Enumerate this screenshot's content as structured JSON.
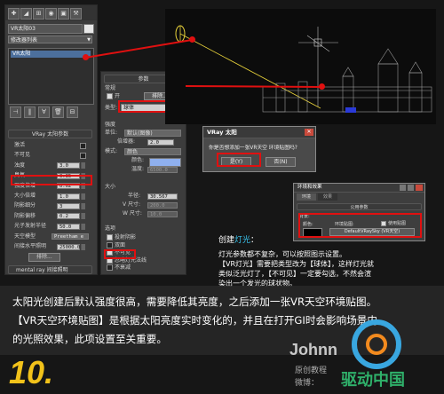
{
  "left_panel": {
    "object_name": "VR太阳03",
    "modifier_list": "修改器列表",
    "stack_item": "VR太阳",
    "rollout_title": "VRay 太阳参数",
    "params": [
      {
        "label": "激活",
        "value": "",
        "kind": "check"
      },
      {
        "label": "不可见",
        "value": "",
        "kind": "check"
      },
      {
        "label": "浊度",
        "value": "3.0",
        "kind": "spin"
      },
      {
        "label": "臭氧",
        "value": "0.35",
        "kind": "spin"
      },
      {
        "label": "强度倍增",
        "value": "0.02",
        "kind": "spin"
      },
      {
        "label": "大小倍增",
        "value": "1.0",
        "kind": "spin"
      },
      {
        "label": "阴影细分",
        "value": "3",
        "kind": "spin"
      },
      {
        "label": "阴影偏移",
        "value": "0.2",
        "kind": "spin"
      },
      {
        "label": "光子发射半径",
        "value": "50.0",
        "kind": "spin"
      },
      {
        "label": "天空模型",
        "value": "Preetham e",
        "kind": "drop"
      },
      {
        "label": "间接水平照明",
        "value": "25000.0",
        "kind": "spin"
      },
      {
        "label": "排除...",
        "value": "",
        "kind": "btn"
      }
    ],
    "footer": "mental ray 间接照明"
  },
  "mid_panel": {
    "rollout_title": "参数",
    "general_group": "常规",
    "on_label": "开",
    "exclude_button": "排除...",
    "type_label": "类型:",
    "type_value": "球体",
    "intensity_group": "强度",
    "unit_label": "单位:",
    "unit_value": "默认(图像)",
    "multiplier_label": "倍增器:",
    "multiplier_value": "2.0",
    "mode_label": "模式:",
    "mode_value": "颜色",
    "color_label": "颜色:",
    "temp_label": "温度:",
    "temp_value": "6500.0",
    "size_group": "大小",
    "half_len_label": "半径:",
    "half_len_value": "30.567",
    "vsize_label": "V 尺寸:",
    "vsize_value": "200.0",
    "wsize_label": "W 尺寸:",
    "wsize_value": "10.0",
    "options_group": "选项",
    "options": [
      {
        "label": "投射阴影",
        "checked": true
      },
      {
        "label": "双面",
        "checked": false
      },
      {
        "label": "不可见",
        "checked": true
      },
      {
        "label": "忽略灯光法线",
        "checked": true
      },
      {
        "label": "不衰减",
        "checked": false
      }
    ]
  },
  "dialog_vray": {
    "title": "VRay 太阳",
    "message": "你是否想添加一张VR天空 环境贴图吗?",
    "yes": "是(Y)",
    "no": "否(N)"
  },
  "dialog_env": {
    "title": "环境和效果",
    "tab_env": "环境",
    "tab_effects": "效果",
    "rollout": "公用参数",
    "bg_group": "背景:",
    "color_label": "颜色:",
    "envmap_label": "环境贴图:",
    "use_map_label": "使用贴图",
    "map_button": "DefaultVRaySky (VR天空)"
  },
  "notes": {
    "heading_prefix": "创建",
    "heading_accent": "灯光",
    "heading_suffix": "：",
    "lines": [
      "灯光参数都不复杂，可以按照图示设置。",
      "【VR灯光】需要把类型改为【球体】，这样灯光就",
      "类似泛光灯了，【不可见】一定要勾选，不然会渲",
      "染出一个发光的球状物。"
    ]
  },
  "caption": {
    "lines": [
      "太阳光创建后默认强度很高，需要降低其亮度，之后添加一张VR天空环境贴图。",
      "【VR天空环境贴图】是根据太阳亮度实时变化的，并且在打开GI时会影响场景内",
      "的光照效果，此项设置至关重要。"
    ]
  },
  "step_number": "10.",
  "watermark": {
    "brand": "Johnn",
    "line1": "原创教程",
    "line2": "微博：",
    "site": "驱动中国"
  },
  "colors": {
    "highlight_red": "#e01010",
    "step_yellow": "#f2c21a",
    "accent_cyan": "#39c6f0",
    "caption_bg": "#2c2c2c"
  }
}
